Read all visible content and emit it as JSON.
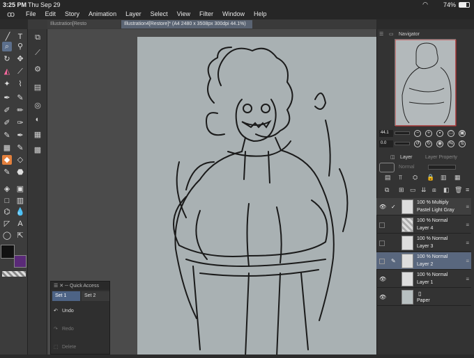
{
  "status": {
    "time": "3:25 PM",
    "date": "Thu Sep 29",
    "battery": "74%",
    "battery_level": 0.74
  },
  "menu": {
    "items": [
      "File",
      "Edit",
      "Story",
      "Animation",
      "Layer",
      "Select",
      "View",
      "Filter",
      "Window",
      "Help"
    ]
  },
  "tabs": [
    {
      "label": "Illustration[Resto"
    },
    {
      "label": "Illustration4[Restore]* (A4 2480 x 3508px 300dpi 44.1%)"
    }
  ],
  "quick_access": {
    "title": "Quick Access",
    "sets": [
      "Set 1",
      "Set 2"
    ],
    "actions": [
      "Undo",
      "Redo",
      "Delete"
    ]
  },
  "navigator": {
    "title": "Navigator",
    "zoom": "44.1",
    "rotation": "0.0"
  },
  "layers_panel": {
    "tab_layer": "Layer",
    "tab_props": "Layer Property",
    "blend_mode": "Normal",
    "layers": [
      {
        "mode": "100 %  Multiply",
        "name": "Pastel Light Gray",
        "visible": true,
        "selected": false
      },
      {
        "mode": "100 %  Normal",
        "name": "Layer 4",
        "visible": false,
        "selected": false
      },
      {
        "mode": "100 %  Normal",
        "name": "Layer 3",
        "visible": false,
        "selected": false
      },
      {
        "mode": "100 %  Normal",
        "name": "Layer 2",
        "visible": false,
        "selected": true
      },
      {
        "mode": "100 %  Normal",
        "name": "Layer 1",
        "visible": true,
        "selected": false
      },
      {
        "mode": "",
        "name": "Paper",
        "visible": true,
        "selected": false
      }
    ]
  },
  "colors": {
    "main": "#111111",
    "sub": "#5a2a78",
    "accent": "#5c6f8c"
  }
}
